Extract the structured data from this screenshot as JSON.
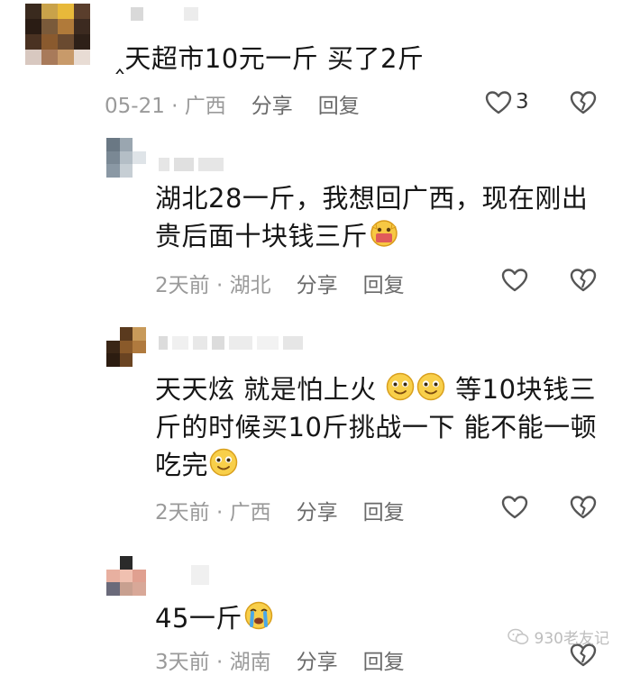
{
  "comments": [
    {
      "text_before": "‸天超市10元一斤 买了2斤",
      "time": "05-21",
      "location": "广西",
      "share_label": "分享",
      "reply_label": "回复",
      "likes": "3"
    },
    {
      "line1": "湖北28一斤，我想回广西，现在刚出",
      "line2": "贵后面十块钱三斤",
      "time": "2天前",
      "location": "湖北",
      "share_label": "分享",
      "reply_label": "回复"
    },
    {
      "line1_a": "天天炫 就是怕上火",
      "line1_b": "等10块钱三",
      "line2": "斤的时候买10斤挑战一下 能不能一顿",
      "line3": "吃完",
      "time": "2天前",
      "location": "广西",
      "share_label": "分享",
      "reply_label": "回复"
    },
    {
      "text": "45一斤",
      "time": "3天前",
      "location": "湖南",
      "share_label": "分享",
      "reply_label": "回复"
    }
  ],
  "separator": " · ",
  "watermark": "930老友记",
  "colors": {
    "text": "#161616",
    "meta": "#9a9a9a",
    "action": "#6a6a6a",
    "icon": "#555555"
  },
  "icons": {
    "like": "heart-outline-icon",
    "dislike": "broken-heart-icon"
  }
}
